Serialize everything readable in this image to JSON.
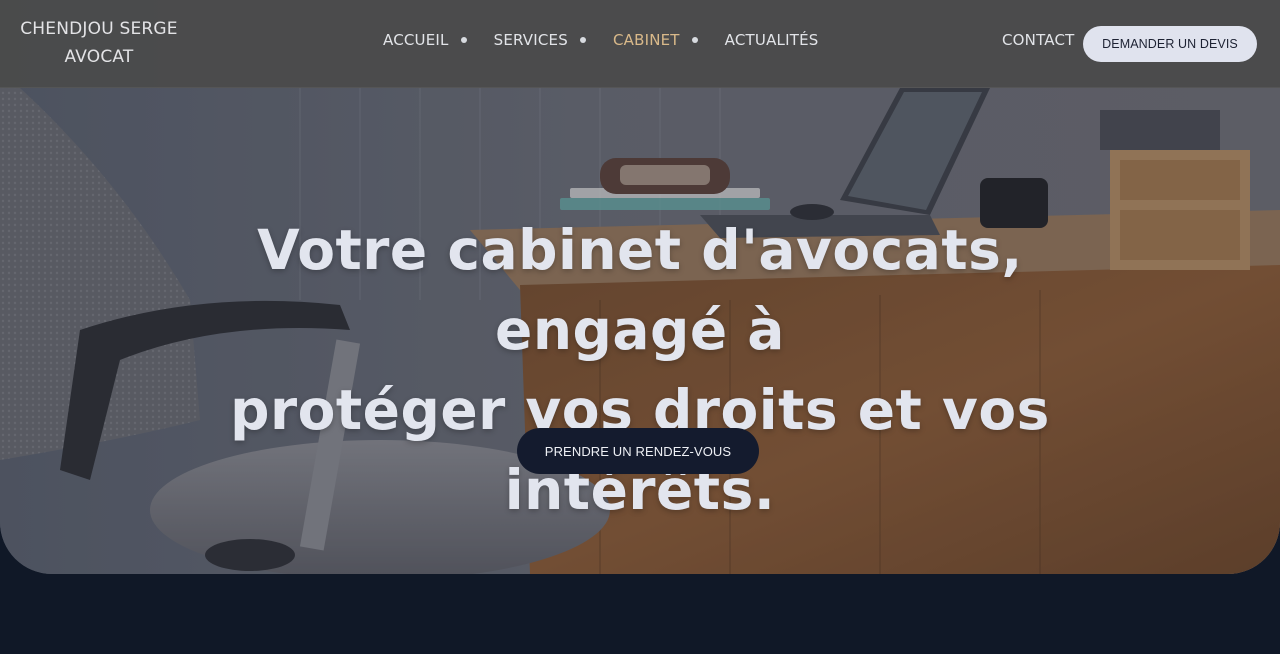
{
  "brand": {
    "line1": "CHENDJOU SERGE",
    "line2": "AVOCAT"
  },
  "nav": {
    "items": [
      {
        "label": "ACCUEIL",
        "active": false,
        "has_dot": true
      },
      {
        "label": "SERVICES",
        "active": false,
        "has_dot": true
      },
      {
        "label": "CABINET",
        "active": true,
        "has_dot": true
      },
      {
        "label": "ACTUALITÉS",
        "active": false,
        "has_dot": false
      }
    ],
    "contact_label": "CONTACT",
    "cta_label": "DEMANDER UN DEVIS"
  },
  "hero": {
    "headline_line1": "Votre cabinet d'avocats, engagé à",
    "headline_line2": "protéger vos droits et vos intérêts.",
    "cta_label": "PRENDRE UN RENDEZ-VOUS",
    "background_image": "office-desk-chair-laptop-photo"
  },
  "colors": {
    "nav_bg": "#4a4a4a",
    "accent_active": "#d9b98a",
    "dark_navy": "#101827",
    "button_light": "#e0e3ee",
    "button_dark": "#141b2e"
  }
}
